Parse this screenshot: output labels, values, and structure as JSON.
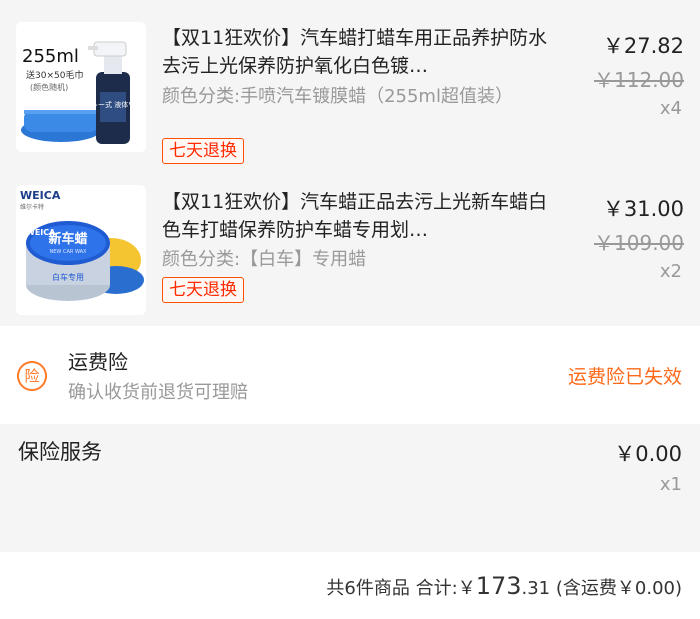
{
  "products": [
    {
      "title": "【双11狂欢价】汽车蜡打蜡车用正品养护防水去污上光保养防护氧化白色镀…",
      "spec": "颜色分类:手喷汽车镀膜蜡（255ml超值装）",
      "badge": "七天退换",
      "price": "￥27.82",
      "original_price": "￥112.00",
      "quantity": "x4",
      "image": {
        "volume_label": "255ml",
        "gift_note": "送30×50毛巾",
        "color_note": "(颜色随机)",
        "bottle_text": "スプレー式 液体ワクス"
      }
    },
    {
      "title": "【双11狂欢价】汽车蜡正品去污上光新车蜡白色车打蜡保养防护车蜡专用划…",
      "spec": "颜色分类:【白车】专用蜡",
      "badge": "七天退换",
      "price": "￥31.00",
      "original_price": "￥109.00",
      "quantity": "x2",
      "image": {
        "brand": "WEICA",
        "brand_sub": "维尔卡特",
        "can_title": "新车蜡",
        "can_sub": "NEW CAR WAX",
        "can_label": "白车专用"
      }
    }
  ],
  "insurance": {
    "icon_glyph": "险",
    "title": "运费险",
    "subtitle": "确认收货前退货可理赔",
    "status": "运费险已失效"
  },
  "service": {
    "title": "保险服务",
    "price": "￥0.00",
    "quantity": "x1"
  },
  "summary": {
    "count_text": "共6件商品",
    "total_label": "合计:",
    "currency": "￥",
    "total_int": "173",
    "total_dec": ".31",
    "shipping_text": "(含运费￥0.00)"
  },
  "colors": {
    "accent": "#ff6a2b",
    "badge_red": "#ff2a00",
    "muted": "#999999"
  }
}
